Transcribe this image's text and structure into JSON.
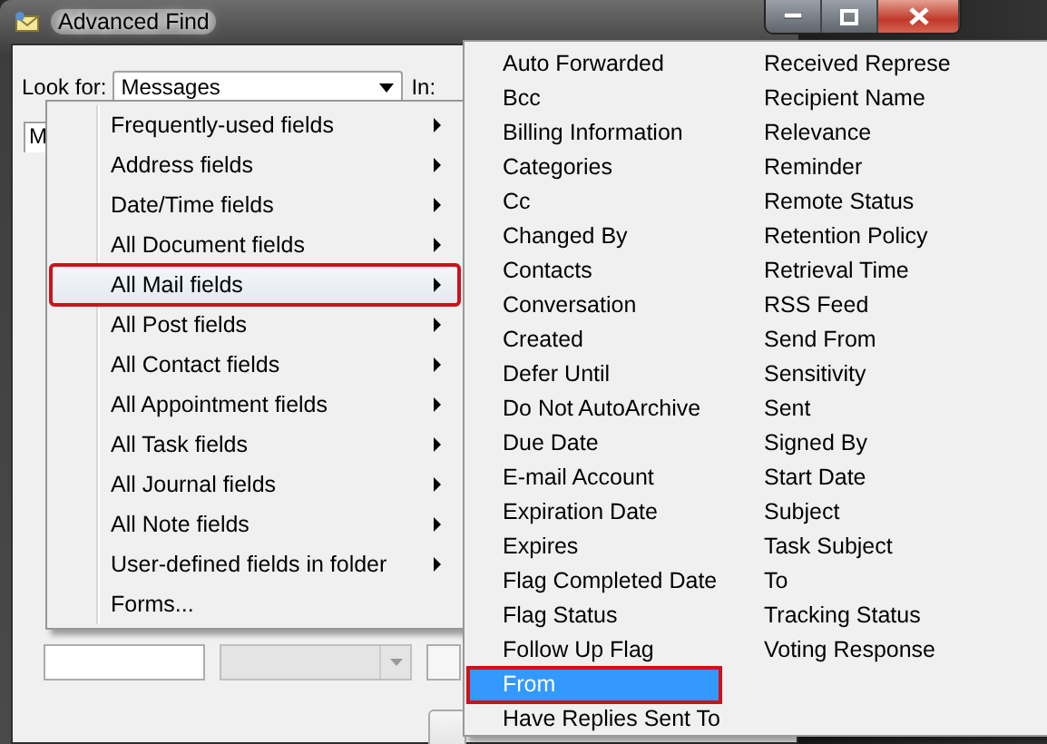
{
  "window": {
    "title": "Advanced Find"
  },
  "look_for": {
    "label": "Look for:",
    "value": "Messages",
    "in_label": "In:"
  },
  "tab": {
    "label": "M"
  },
  "field_menu": {
    "items": [
      {
        "label": "Frequently-used fields",
        "submenu": true,
        "selected": false,
        "outlined": false
      },
      {
        "label": "Address fields",
        "submenu": true,
        "selected": false,
        "outlined": false
      },
      {
        "label": "Date/Time fields",
        "submenu": true,
        "selected": false,
        "outlined": false
      },
      {
        "label": "All Document fields",
        "submenu": true,
        "selected": false,
        "outlined": false
      },
      {
        "label": "All Mail fields",
        "submenu": true,
        "selected": true,
        "outlined": true
      },
      {
        "label": "All Post fields",
        "submenu": true,
        "selected": false,
        "outlined": false
      },
      {
        "label": "All Contact fields",
        "submenu": true,
        "selected": false,
        "outlined": false
      },
      {
        "label": "All Appointment fields",
        "submenu": true,
        "selected": false,
        "outlined": false
      },
      {
        "label": "All Task fields",
        "submenu": true,
        "selected": false,
        "outlined": false
      },
      {
        "label": "All Journal fields",
        "submenu": true,
        "selected": false,
        "outlined": false
      },
      {
        "label": "All Note fields",
        "submenu": true,
        "selected": false,
        "outlined": false
      },
      {
        "label": "User-defined fields in folder",
        "submenu": true,
        "selected": false,
        "outlined": false
      },
      {
        "label": "Forms...",
        "submenu": false,
        "selected": false,
        "outlined": false
      }
    ]
  },
  "mail_fields_menu": {
    "columns": [
      [
        {
          "label": "Auto Forwarded",
          "selected": false,
          "outlined": false
        },
        {
          "label": "Bcc",
          "selected": false,
          "outlined": false
        },
        {
          "label": "Billing Information",
          "selected": false,
          "outlined": false
        },
        {
          "label": "Categories",
          "selected": false,
          "outlined": false
        },
        {
          "label": "Cc",
          "selected": false,
          "outlined": false
        },
        {
          "label": "Changed By",
          "selected": false,
          "outlined": false
        },
        {
          "label": "Contacts",
          "selected": false,
          "outlined": false
        },
        {
          "label": "Conversation",
          "selected": false,
          "outlined": false
        },
        {
          "label": "Created",
          "selected": false,
          "outlined": false
        },
        {
          "label": "Defer Until",
          "selected": false,
          "outlined": false
        },
        {
          "label": "Do Not AutoArchive",
          "selected": false,
          "outlined": false
        },
        {
          "label": "Due Date",
          "selected": false,
          "outlined": false
        },
        {
          "label": "E-mail Account",
          "selected": false,
          "outlined": false
        },
        {
          "label": "Expiration Date",
          "selected": false,
          "outlined": false
        },
        {
          "label": "Expires",
          "selected": false,
          "outlined": false
        },
        {
          "label": "Flag Completed Date",
          "selected": false,
          "outlined": false
        },
        {
          "label": "Flag Status",
          "selected": false,
          "outlined": false
        },
        {
          "label": "Follow Up Flag",
          "selected": false,
          "outlined": false
        },
        {
          "label": "From",
          "selected": true,
          "outlined": true
        },
        {
          "label": "Have Replies Sent To",
          "selected": false,
          "outlined": false
        }
      ],
      [
        {
          "label": "Received Represe",
          "selected": false,
          "outlined": false
        },
        {
          "label": "Recipient Name",
          "selected": false,
          "outlined": false
        },
        {
          "label": "Relevance",
          "selected": false,
          "outlined": false
        },
        {
          "label": "Reminder",
          "selected": false,
          "outlined": false
        },
        {
          "label": "Remote Status",
          "selected": false,
          "outlined": false
        },
        {
          "label": "Retention Policy",
          "selected": false,
          "outlined": false
        },
        {
          "label": "Retrieval Time",
          "selected": false,
          "outlined": false
        },
        {
          "label": "RSS Feed",
          "selected": false,
          "outlined": false
        },
        {
          "label": "Send From",
          "selected": false,
          "outlined": false
        },
        {
          "label": "Sensitivity",
          "selected": false,
          "outlined": false
        },
        {
          "label": "Sent",
          "selected": false,
          "outlined": false
        },
        {
          "label": "Signed By",
          "selected": false,
          "outlined": false
        },
        {
          "label": "Start Date",
          "selected": false,
          "outlined": false
        },
        {
          "label": "Subject",
          "selected": false,
          "outlined": false
        },
        {
          "label": "Task Subject",
          "selected": false,
          "outlined": false
        },
        {
          "label": "To",
          "selected": false,
          "outlined": false
        },
        {
          "label": "Tracking Status",
          "selected": false,
          "outlined": false
        },
        {
          "label": "Voting Response",
          "selected": false,
          "outlined": false
        }
      ]
    ]
  }
}
